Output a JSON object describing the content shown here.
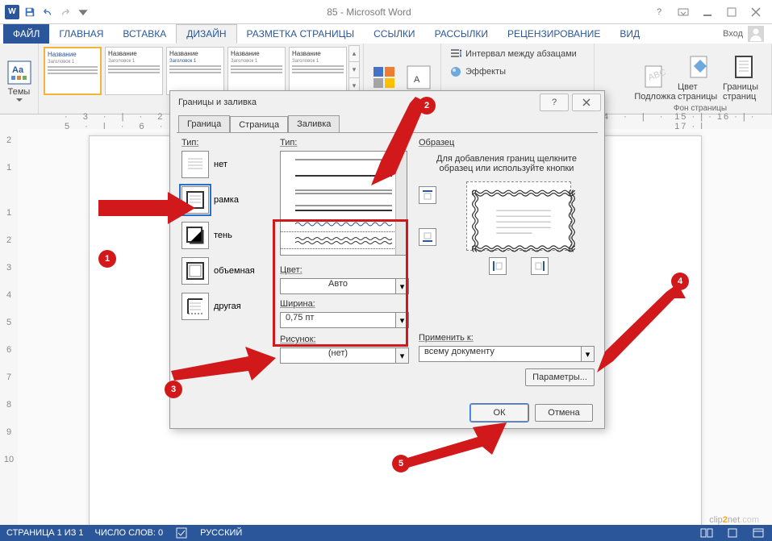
{
  "titlebar": {
    "title": "85 - Microsoft Word",
    "account": "Вход"
  },
  "tabs": {
    "file": "ФАЙЛ",
    "home": "ГЛАВНАЯ",
    "insert": "ВСТАВКА",
    "design": "ДИЗАЙН",
    "layout": "РАЗМЕТКА СТРАНИЦЫ",
    "refs": "ССЫЛКИ",
    "mail": "РАССЫЛКИ",
    "review": "РЕЦЕНЗИРОВАНИЕ",
    "view": "ВИД"
  },
  "ribbon": {
    "themes": "Темы",
    "style_title": "Название",
    "style_sub": "Заголовок 1",
    "colors": "Цвета",
    "fonts": "Шрифты",
    "spacing": "Интервал между абзацами",
    "effects": "Эффекты",
    "watermark": "Подложка",
    "pagecolor": "Цвет страницы",
    "borders": "Границы страниц",
    "group_bg": "Фон страницы"
  },
  "dialog": {
    "title": "Границы и заливка",
    "tabs": {
      "border": "Граница",
      "page": "Страница",
      "fill": "Заливка"
    },
    "type_label": "Тип:",
    "types": {
      "none": "нет",
      "box": "рамка",
      "shadow": "тень",
      "threeD": "объемная",
      "custom": "другая"
    },
    "style_label": "Тип:",
    "color_label": "Цвет:",
    "color_value": "Авто",
    "width_label": "Ширина:",
    "width_value": "0,75 пт",
    "art_label": "Рисунок:",
    "art_value": "(нет)",
    "preview_label": "Образец",
    "preview_text": "Для добавления границ щелкните образец или используйте кнопки",
    "apply_label": "Применить к:",
    "apply_value": "всему документу",
    "options": "Параметры...",
    "ok": "ОК",
    "cancel": "Отмена"
  },
  "status": {
    "page": "СТРАНИЦА 1 ИЗ 1",
    "words": "ЧИСЛО СЛОВ: 0",
    "lang": "РУССКИЙ"
  },
  "ruler": {
    "h": "· 3 · | · 2 · | · 1 · | · · · | · 1 · | · 2 · | · 3 · | · 4 · | · 5 · | · 6 ·",
    "htail": " 15 · | · 16 · | · 17 · |"
  },
  "watermark": {
    "a": "clip",
    "b": "2",
    "c": "net",
    "d": ".com"
  },
  "badges": {
    "n1": "1",
    "n2": "2",
    "n3": "3",
    "n4": "4",
    "n5": "5"
  }
}
